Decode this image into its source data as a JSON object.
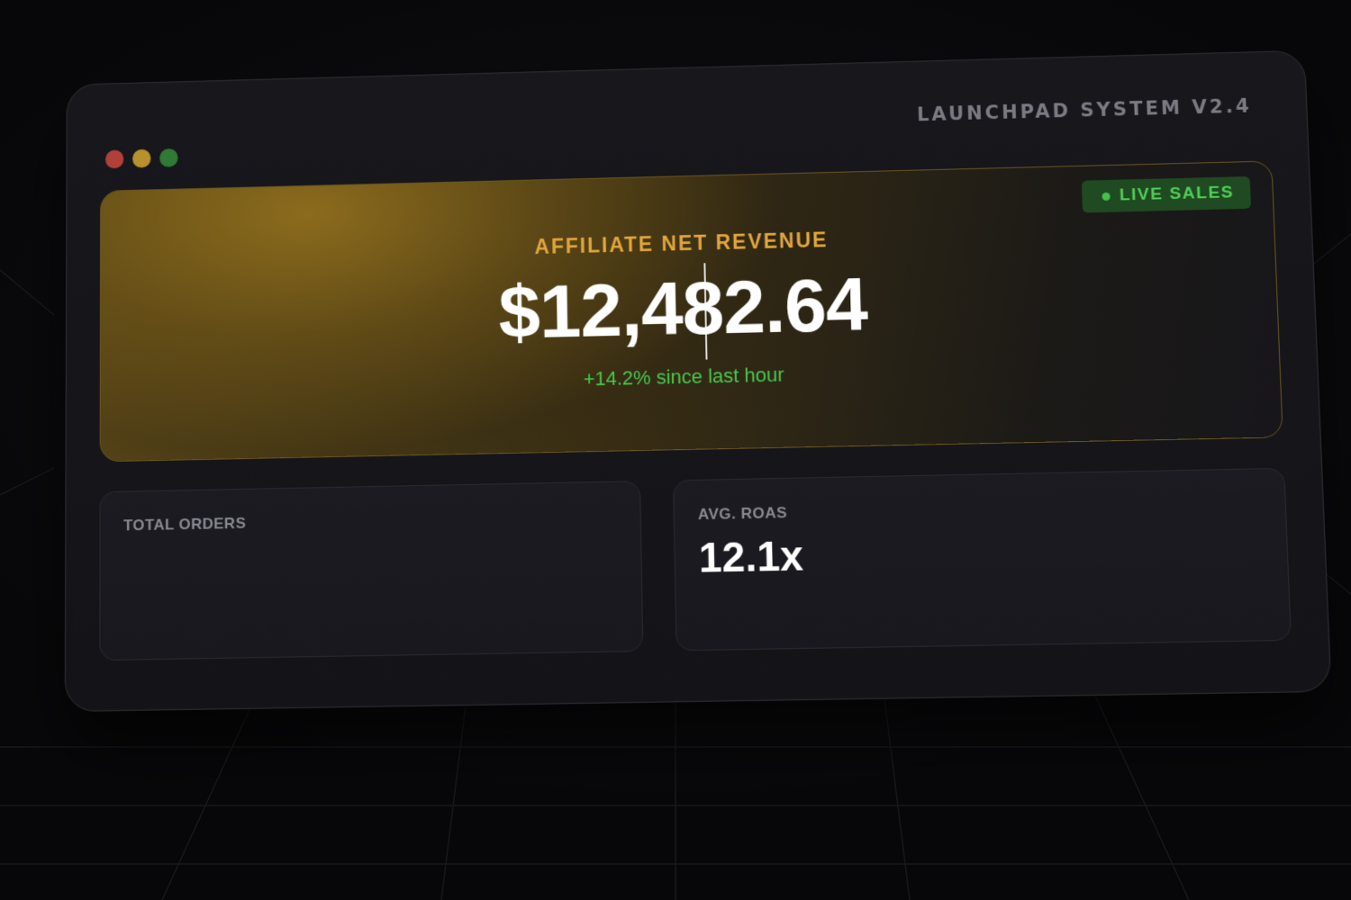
{
  "window": {
    "title": "LAUNCHPAD SYSTEM V2.4"
  },
  "revenue": {
    "label": "AFFILIATE NET REVENUE",
    "value": "$12,482.64",
    "change": "+14.2% since last hour",
    "badge": "LIVE SALES"
  },
  "stats": {
    "orders": {
      "label": "TOTAL ORDERS",
      "value": ""
    },
    "roas": {
      "label": "AVG. ROAS",
      "value": "12.1x"
    }
  },
  "colors": {
    "accent_gold": "#e2a53c",
    "positive_green": "#47c94e",
    "badge_bg": "#1f4a22",
    "traffic_red": "#b1403a",
    "traffic_yellow": "#b8902e",
    "traffic_green": "#2f7a34"
  }
}
